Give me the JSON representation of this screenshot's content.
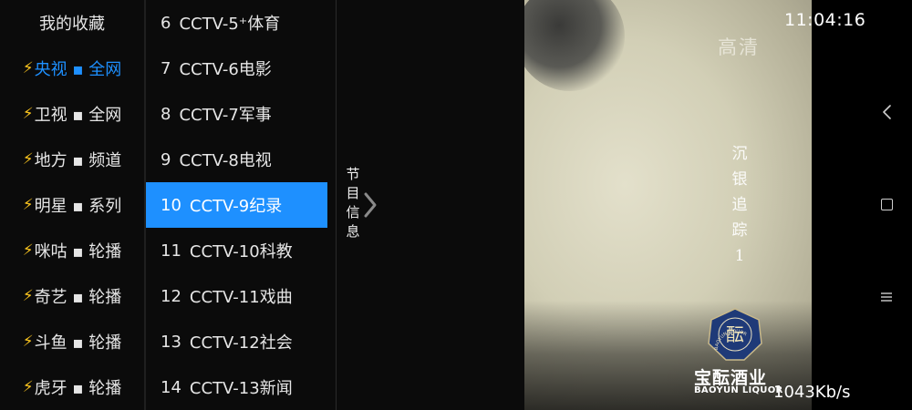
{
  "categories": [
    {
      "label": "我的收藏",
      "bolt": false,
      "active": false
    },
    {
      "label": "央视 ▪ 全网",
      "bolt": true,
      "active": true
    },
    {
      "label": "卫视 ▪ 全网",
      "bolt": true,
      "active": false
    },
    {
      "label": "地方 ▪ 频道",
      "bolt": true,
      "active": false
    },
    {
      "label": "明星 ▪ 系列",
      "bolt": true,
      "active": false
    },
    {
      "label": "咪咕 ▪ 轮播",
      "bolt": true,
      "active": false
    },
    {
      "label": "奇艺 ▪ 轮播",
      "bolt": true,
      "active": false
    },
    {
      "label": "斗鱼 ▪ 轮播",
      "bolt": true,
      "active": false
    },
    {
      "label": "虎牙 ▪ 轮播",
      "bolt": true,
      "active": false
    }
  ],
  "channels": [
    {
      "num": "6",
      "name": "CCTV-5⁺体育",
      "selected": false
    },
    {
      "num": "7",
      "name": "CCTV-6电影",
      "selected": false
    },
    {
      "num": "8",
      "name": "CCTV-7军事",
      "selected": false
    },
    {
      "num": "9",
      "name": "CCTV-8电视",
      "selected": false
    },
    {
      "num": "10",
      "name": "CCTV-9纪录",
      "selected": true
    },
    {
      "num": "11",
      "name": "CCTV-10科教",
      "selected": false
    },
    {
      "num": "12",
      "name": "CCTV-11戏曲",
      "selected": false
    },
    {
      "num": "13",
      "name": "CCTV-12社会",
      "selected": false
    },
    {
      "num": "14",
      "name": "CCTV-13新闻",
      "selected": false
    }
  ],
  "epg": {
    "tab_label": "节目信息"
  },
  "video": {
    "hd_badge": "高清",
    "title_vertical": "沉银追踪1",
    "logo_glyph": "酝",
    "logo_ring_text": "BAOYUN LIQUOR",
    "logo_cn": "宝酝酒业",
    "logo_en": "BAOYUN LIQUOR"
  },
  "status": {
    "clock": "11:04:16",
    "speed": "1043Kb/s"
  },
  "colors": {
    "accent": "#1e90ff",
    "bolt": "#f7c21e",
    "logo_navy": "#1f3a78"
  }
}
